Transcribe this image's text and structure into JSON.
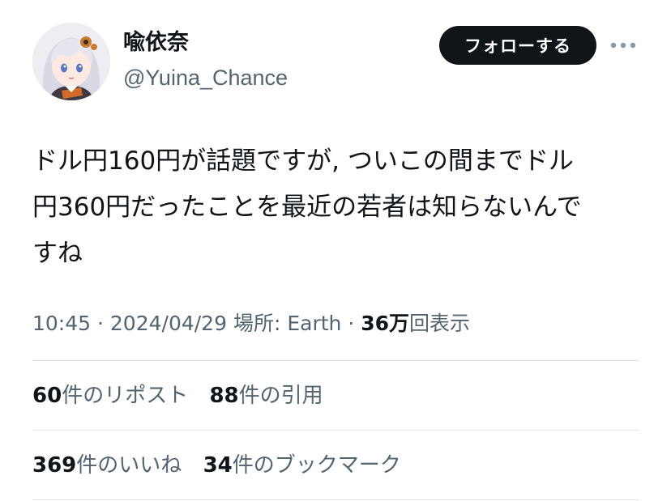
{
  "user": {
    "display_name": "喩依奈",
    "handle": "@Yuina_Chance"
  },
  "header": {
    "follow_label": "フォローする",
    "more_icon": "ellipsis-icon"
  },
  "tweet": {
    "text_lines": [
      "ドル円160円が話題ですが, ついこの間までドル",
      "円360円だったことを最近の若者は知らないんで",
      "すね"
    ]
  },
  "meta": {
    "time": "10:45",
    "separator": "·",
    "date": "2024/04/29",
    "location_label": "場所: Earth",
    "views_count": "36万",
    "views_label": "回表示"
  },
  "stats": {
    "reposts_count": "60",
    "reposts_label": "件のリポスト",
    "quotes_count": "88",
    "quotes_label": "件の引用",
    "likes_count": "369",
    "likes_label": "件のいいね",
    "bookmarks_count": "34",
    "bookmarks_label": "件のブックマーク"
  },
  "colors": {
    "text_primary": "#0f1419",
    "text_secondary": "#536471",
    "button_bg": "#0f1419",
    "divider": "#e3e6e9"
  }
}
